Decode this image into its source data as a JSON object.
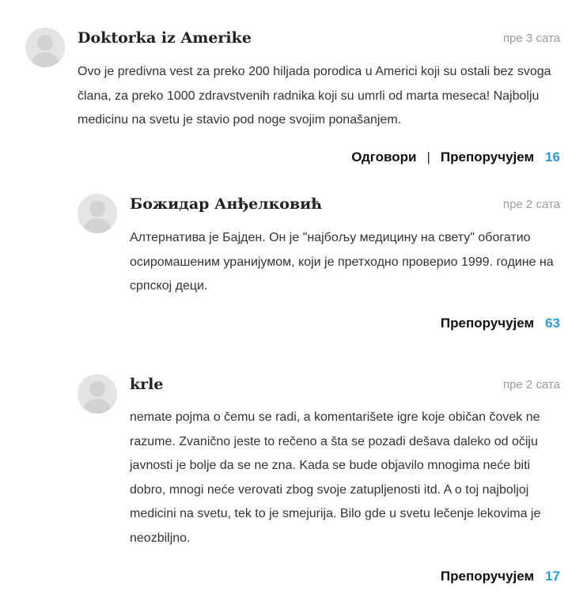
{
  "comments": [
    {
      "author": "Doktorka iz Amerike",
      "time": "пре 3 сата",
      "text": "Ovo je predivna vest za preko 200 hiljada porodica u Americi koji su ostali bez svoga člana, za preko 1000 zdravstvenih radnika koji su umrli od marta meseca! Najbolju medicinu na svetu je stavio pod noge svojim ponašanjem.",
      "reply_label": "Одговори",
      "separator": "|",
      "recommend_label": "Препоручујем",
      "recommend_count": "16"
    },
    {
      "author": "Божидар Анђелковић",
      "time": "пре 2 сата",
      "text": "Алтернатива је Бајден. Он је \"најбољу медицину на свету\" обогатио осиромашеним уранијумом, који је претходно проверио 1999. године на српској деци.",
      "recommend_label": "Препоручујем",
      "recommend_count": "63"
    },
    {
      "author": "krle",
      "time": "пре 2 сата",
      "text": "nemate pojma o čemu se radi, a komentarišete igre koje običan čovek ne razume. Zvanično jeste to rečeno a šta se pozadi dešava daleko od očiju javnosti je bolje da se ne zna. Kada se bude objavilo mnogima neće biti dobro, mnogi neće verovati zbog svoje zatupljenosti itd. A o toj najboljoj medicini na svetu, tek to je smejurija. Bilo gde u svetu lečenje lekovima je neozbiljno.",
      "recommend_label": "Препоручујем",
      "recommend_count": "17"
    }
  ]
}
